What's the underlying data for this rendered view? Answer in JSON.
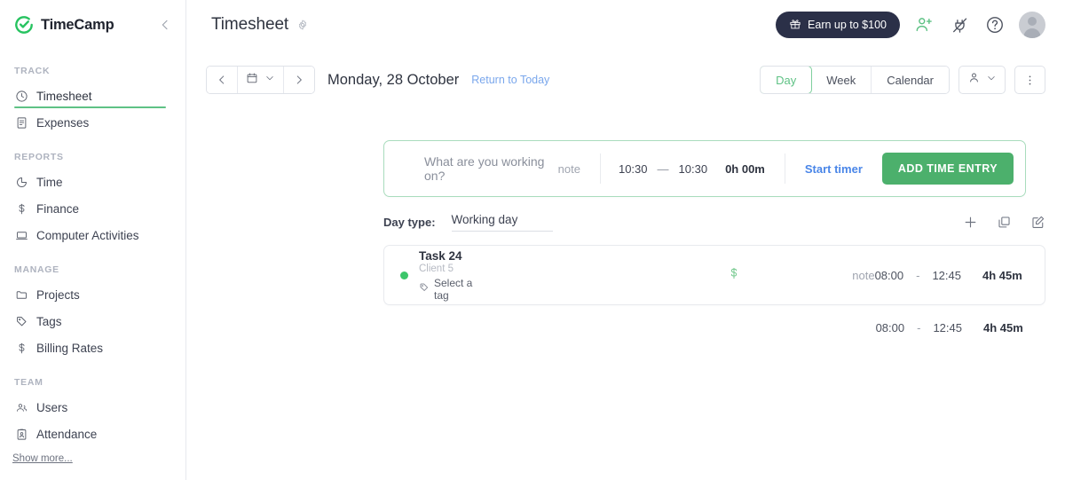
{
  "brand": {
    "name": "TimeCamp",
    "logo_icon": "check-circle-icon",
    "collapse_icon": "chevron-left-icon"
  },
  "sidebar": {
    "groups": [
      {
        "label": "TRACK",
        "items": [
          {
            "label": "Timesheet",
            "icon": "clock-icon",
            "active": true
          },
          {
            "label": "Expenses",
            "icon": "receipt-icon",
            "active": false
          }
        ]
      },
      {
        "label": "REPORTS",
        "items": [
          {
            "label": "Time",
            "icon": "pie-chart-icon",
            "active": false
          },
          {
            "label": "Finance",
            "icon": "dollar-icon",
            "active": false
          },
          {
            "label": "Computer Activities",
            "icon": "laptop-icon",
            "active": false
          }
        ]
      },
      {
        "label": "MANAGE",
        "items": [
          {
            "label": "Projects",
            "icon": "folder-icon",
            "active": false
          },
          {
            "label": "Tags",
            "icon": "tag-icon",
            "active": false
          },
          {
            "label": "Billing Rates",
            "icon": "dollar-icon",
            "active": false
          }
        ]
      },
      {
        "label": "TEAM",
        "items": [
          {
            "label": "Users",
            "icon": "users-icon",
            "active": false
          },
          {
            "label": "Attendance",
            "icon": "badge-person-icon",
            "active": false
          }
        ]
      }
    ],
    "show_more": "Show more..."
  },
  "header": {
    "title": "Timesheet",
    "gear_icon": "gear-icon",
    "earn_label": "Earn up to $100",
    "earn_icon": "gift-icon",
    "invite_icon": "add-user-icon",
    "integrations_icon": "plug-off-icon",
    "help_icon": "question-circle-icon",
    "avatar_icon": "avatar"
  },
  "toolbar": {
    "prev_icon": "chevron-left-icon",
    "calendar_icon": "calendar-icon",
    "calendar_caret_icon": "chevron-down-icon",
    "next_icon": "chevron-right-icon",
    "current_date": "Monday, 28 October",
    "return_today": "Return to Today",
    "views": [
      {
        "label": "Day",
        "active": true
      },
      {
        "label": "Week",
        "active": false
      },
      {
        "label": "Calendar",
        "active": false
      }
    ],
    "user_filter_icon": "person-icon",
    "user_filter_caret_icon": "chevron-down-icon",
    "more_icon": "vertical-dots-icon"
  },
  "timer": {
    "placeholder": "What are you working on?",
    "note_label": "note",
    "start_time": "10:30",
    "dash": "—",
    "end_time": "10:30",
    "duration": "0h 00m",
    "start_timer_label": "Start timer",
    "add_entry_label": "ADD TIME ENTRY",
    "accent_color": "#4cb06c",
    "border_color": "#a9dcbd"
  },
  "daytype": {
    "label": "Day type:",
    "value": "Working day",
    "add_icon": "plus-icon",
    "duplicate_icon": "copy-icon",
    "edit_icon": "pencil-square-icon"
  },
  "entries": [
    {
      "task": "Task 24",
      "client": "Client 5",
      "tag_placeholder": "Select a tag",
      "tag_icon": "tag-icon",
      "billable_icon": "dollar-icon",
      "note_label": "note",
      "start_time": "08:00",
      "dash": "-",
      "end_time": "12:45",
      "duration": "4h 45m",
      "dot_color": "#3cc66a"
    }
  ],
  "summary": {
    "start_time": "08:00",
    "dash": "-",
    "end_time": "12:45",
    "total": "4h 45m"
  }
}
